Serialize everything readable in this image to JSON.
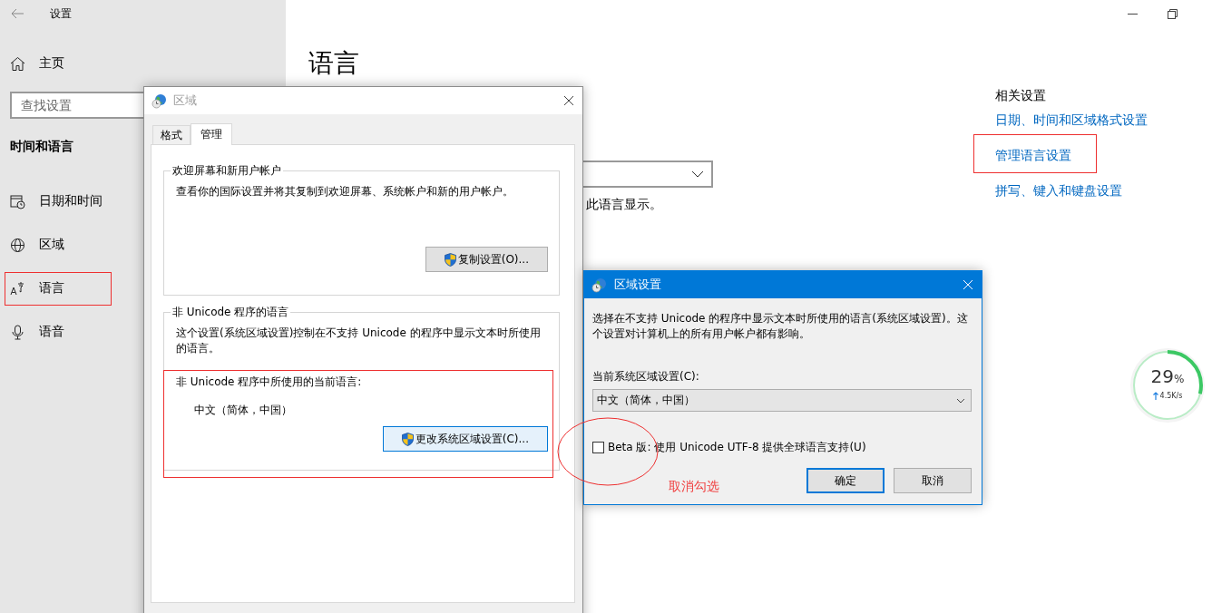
{
  "settings_window": {
    "title": "设置",
    "home": "主页",
    "search": {
      "placeholder": "查找设置"
    },
    "section_title": "时间和语言",
    "nav_items": [
      {
        "label": "日期和时间"
      },
      {
        "label": "区域"
      },
      {
        "label": "语言"
      },
      {
        "label": "语音"
      }
    ],
    "heading": "语言",
    "display_note": "此语言显示。",
    "related": {
      "title": "相关设置",
      "links": [
        "日期、时间和区域格式设置",
        "管理语言设置",
        "拼写、键入和键盘设置"
      ]
    }
  },
  "region_dialog": {
    "title": "区域",
    "tabs": [
      {
        "label": "格式",
        "selected": false
      },
      {
        "label": "管理",
        "selected": true
      }
    ],
    "groups": [
      {
        "legend": "欢迎屏幕和新用户帐户",
        "text": "查看你的国际设置并将其复制到欢迎屏幕、系统帐户和新的用户帐户。",
        "button": {
          "label": "复制设置(O)...",
          "focused": false
        }
      },
      {
        "legend": "非 Unicode 程序的语言",
        "text": "这个设置(系统区域设置)控制在不支持 Unicode 的程序中显示文本时所使用的语言。",
        "current_label": "非 Unicode 程序中所使用的当前语言:",
        "current_value": "中文（简体，中国）",
        "button": {
          "label": "更改系统区域设置(C)...",
          "focused": true
        }
      }
    ]
  },
  "locale_dialog": {
    "title": "区域设置",
    "text": "选择在不支持 Unicode 的程序中显示文本时所使用的语言(系统区域设置)。这个设置对计算机上的所有用户帐户都有影响。",
    "combo_label": "当前系统区域设置(C):",
    "combo_value": "中文（简体，中国）",
    "beta": {
      "label": "Beta 版: 使用 Unicode UTF-8 提供全球语言支持(U)",
      "checked": false
    },
    "buttons": [
      {
        "label": "确定",
        "default": true
      },
      {
        "label": "取消",
        "default": false
      }
    ]
  },
  "annotation": {
    "note": "取消勾选"
  },
  "network_meter": {
    "value": "29",
    "unit": "%",
    "speed": "4.5K/s",
    "level": 0.29
  }
}
